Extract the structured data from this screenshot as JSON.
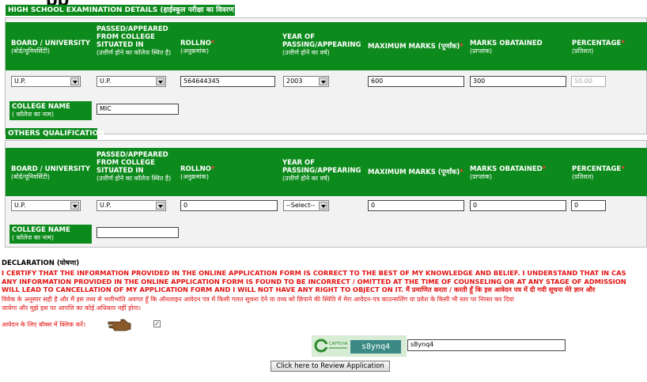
{
  "page_heading_fragment": "pp",
  "high_school": {
    "title": "HIGH SCHOOL EXAMINATION DETAILS (हाईस्कूल परीक्षा का विवरण)",
    "headers": {
      "board": "BOARD / UNIVERSITY",
      "board_hi": "(बोर्ड/यूनिवर्सिटी)",
      "passed": "PASSED/APPEARED FROM COLLEGE SITUATED IN",
      "passed_hi": "(उत्तीर्ण होने का कॉलेज स्थित है)",
      "rollno": "ROLLNO",
      "rollno_hi": "(अनुक्रमांक)",
      "year": "YEAR OF PASSING/APPEARING",
      "year_hi": "(उत्तीर्ण होने का वर्ष)",
      "max": "MAXIMUM MARKS (पूर्णांक)",
      "obt": "MARKS OBATAINED",
      "obt_hi": "(प्राप्तांक)",
      "pct": "PERCENTAGE",
      "pct_hi": "(प्रतिशत)"
    },
    "values": {
      "board": "U.P.",
      "passed": "U.P.",
      "rollno": "564644345",
      "year": "2003",
      "max": "600",
      "obt": "300",
      "pct": "50.00"
    },
    "college_label": "COLLEGE NAME",
    "college_label_hi": "( कॉलेज का नाम)",
    "college_value": "MIC"
  },
  "others": {
    "title": "OTHERS QUALIFICATION",
    "headers": {
      "board": "BOARD / UNIVERSITY",
      "board_hi": "(बोर्ड/यूनिवर्सिटी)",
      "passed": "PASSED/APPEARED FROM COLLEGE SITUATED IN",
      "passed_hi": "(उत्तीर्ण होने का कॉलेज स्थित है)",
      "rollno": "ROLLNO",
      "rollno_hi": "(अनुक्रमांक)",
      "year": "YEAR OF PASSING/APPEARING",
      "year_hi": "(उत्तीर्ण होने का वर्ष)",
      "max": "MAXIMUM MARKS (पूर्णांक)",
      "obt": "MARKS OBATAINED",
      "obt_hi": "(प्राप्तांक)",
      "pct": "PERCENTAGE",
      "pct_hi": "(प्रतिशत)"
    },
    "values": {
      "board": "U.P.",
      "passed": "U.P.",
      "rollno": "0",
      "year": "--Select--",
      "max": "0",
      "obt": "0",
      "pct": "0"
    },
    "college_label": "COLLEGE NAME",
    "college_label_hi": "( कॉलेज का नाम)",
    "college_value": ""
  },
  "declaration": {
    "heading": "DECLARATION (घोषणा)",
    "line1": "I CERTIFY THAT THE INFORMATION PROVIDED IN THE ONLINE APPLICATION FORM IS CORRECT TO THE BEST OF MY KNOWLEDGE AND BELIEF. I UNDERSTAND THAT IN CAS",
    "line2": "ANY INFORMATION PROVIDED IN THE ONLINE APPLICATION FORM IS FOUND TO BE INCORRECT / OMITTED AT THE TIME OF COUNSELING OR AT ANY STAGE OF ADMISSION",
    "line3": "WILL LEAD TO CANCELLATION OF MY APPLICATION FORM AND I WILL NOT HAVE ANY RIGHT TO OBJECT ON IT. मैं प्रमाणित करता / करती हूँ कि इस आवेदन पत्र में दी गयी सूचना मेरे ज्ञान और",
    "hindi1": "विवेक के अनुसार सही है और मैं इस तथ्य से भलीभांति अवगत हूँ कि ऑनलाइन आवेदन पत्र में किसी गलत सूचना देने या तथ्य को छिपाने की स्थिति में मेरा आवेदन-पत्र काउन्सलिंग या प्रवेश के किसी भी स्तर पर निरस्त कर दिया",
    "hindi2": "जायेगा और मुझे इस पर आपत्ति का कोई अधिकार नहीं होगा।",
    "checkbox_label": "आवेदन के लिए बॉक्स में क्लिक करें।"
  },
  "captcha": {
    "logo_text": "CAPTCHA",
    "code": "s8ynq4",
    "input_value": "s8ynq4"
  },
  "review_button": "Click here to Review Application",
  "colors": {
    "section_green": "#0d8a1c",
    "declaration_red": "#e31313",
    "captcha_teal": "#3c8a86"
  }
}
